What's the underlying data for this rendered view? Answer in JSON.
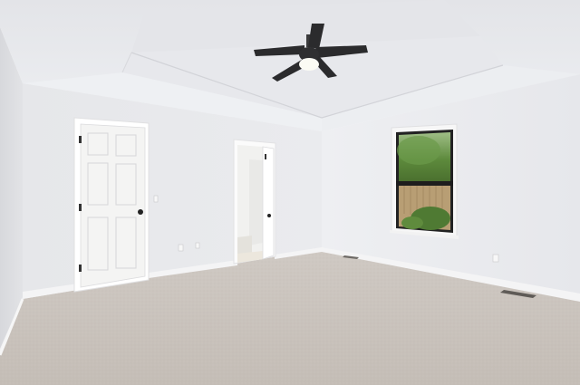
{
  "scene": {
    "kind": "empty-bedroom-interior",
    "colors": {
      "ceiling": "#e9eaee",
      "tray_ceiling": "#e2e3e7",
      "left_wall": "#dfe0e3",
      "back_wall": "#e8e9ec",
      "right_wall": "#ecedf0",
      "carpet": "#c9c2bb",
      "door": "#f3f3f2",
      "fan_blade": "#2b2b2d",
      "foliage": "#4f7a33",
      "fence": "#b8a07a"
    },
    "objects": [
      "tray-ceiling",
      "ceiling-fan",
      "panel-door",
      "bathroom-doorway",
      "window",
      "carpet",
      "baseboards",
      "outlets",
      "floor-vents"
    ]
  }
}
